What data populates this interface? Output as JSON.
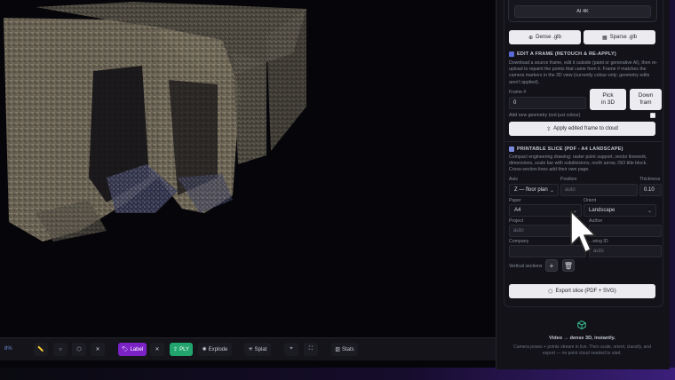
{
  "colors": {
    "accent_purple": "#7b22c7",
    "accent_green": "#21a56c",
    "panel_bg": "#121218",
    "button_light": "#ececf0"
  },
  "toolbar": {
    "counter": "8%",
    "label_btn": "Label",
    "ply_btn": "PLY",
    "explode_btn": "Explode",
    "splat_btn": "Splat",
    "stats_btn": "Stats",
    "icons": [
      "ruler-icon",
      "circle-icon",
      "cube-icon",
      "close-icon",
      "tag-icon",
      "close-icon",
      "upload-icon",
      "explode-icon",
      "splat-icon",
      "focus-icon",
      "fullscreen-icon",
      "stats-icon"
    ]
  },
  "panel": {
    "ai4k_label": "AI 4K",
    "dense_btn": "Dense .glb",
    "sparse_btn": "Sparse .glb",
    "edit_frame": {
      "heading": "EDIT A FRAME (RETOUCH & RE-APPLY)",
      "description": "Download a source frame, edit it outside (paint or generative AI), then re-upload to repaint the points that came from it. Frame # matches the camera markers in the 3D view (currently colour-only; geometry edits aren't applied).",
      "frame_label": "Frame #",
      "frame_value": "0",
      "pick_btn_line1": "Pick",
      "pick_btn_line2": "in 3D",
      "down_btn_line1": "Down",
      "down_btn_line2": "fram",
      "geometry_label": "Add new geometry (not just colour)",
      "apply_btn": "Apply edited frame to cloud"
    },
    "slice": {
      "heading": "PRINTABLE SLICE (PDF - A4 LANDSCAPE)",
      "description": "Compact engineering drawing: raster point support, vector linework, dimensions, scale bar with subdivisions, north arrow, ISO title block. Cross-section lines add their own page.",
      "axis_label": "Axis",
      "axis_value": "Z — floor plan",
      "position_label": "Position",
      "position_placeholder": "auto",
      "thickness_label": "Thickness",
      "thickness_value": "0.10",
      "paper_label": "Paper",
      "paper_value": "A4",
      "orient_label": "Orient",
      "orient_value": "Landscape",
      "project_label": "Project",
      "project_placeholder": "auto",
      "author_label": "Author",
      "author_value": "",
      "company_label": "Company",
      "company_value": "",
      "drawing_id_label": "...wing ID",
      "drawing_id_placeholder": "auto",
      "vertical_sections_label": "Vertical sections",
      "export_btn": "Export slice (PDF + SVG)"
    },
    "footer": {
      "title": "Video → dense 3D, instantly.",
      "text": "Camera poses + points stream in live. Then scale, orient, classify, and export — no point cloud needed to start."
    }
  }
}
